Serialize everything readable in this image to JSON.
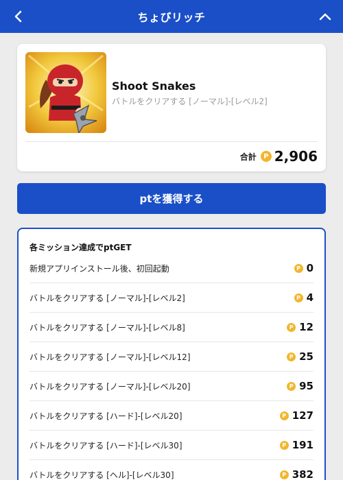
{
  "header": {
    "title": "ちょびリッチ"
  },
  "app": {
    "name": "Shoot Snakes",
    "subtitle": "バトルをクリアする [ノーマル]-[レベル2]",
    "total_label": "合計",
    "total_value": "2,906"
  },
  "get_button": {
    "label": "ptを獲得する"
  },
  "missions": {
    "heading": "各ミッション達成でptGET",
    "items": [
      {
        "label": "新規アプリインストール後、初回起動",
        "points": "0"
      },
      {
        "label": "バトルをクリアする [ノーマル]-[レベル2]",
        "points": "4"
      },
      {
        "label": "バトルをクリアする [ノーマル]-[レベル8]",
        "points": "12"
      },
      {
        "label": "バトルをクリアする [ノーマル]-[レベル12]",
        "points": "25"
      },
      {
        "label": "バトルをクリアする [ノーマル]-[レベル20]",
        "points": "95"
      },
      {
        "label": "バトルをクリアする [ハード]-[レベル20]",
        "points": "127"
      },
      {
        "label": "バトルをクリアする [ハード]-[レベル30]",
        "points": "191"
      },
      {
        "label": "バトルをクリアする [ヘル]-[レベル30]",
        "points": "382"
      }
    ]
  },
  "icons": {
    "back": "chevron-left-icon",
    "collapse": "chevron-up-icon",
    "coin": "point-coin-icon",
    "coin_glyph": "P"
  },
  "colors": {
    "brand": "#1a4fc8",
    "coin": "#f2b62e",
    "background": "#ececec"
  }
}
